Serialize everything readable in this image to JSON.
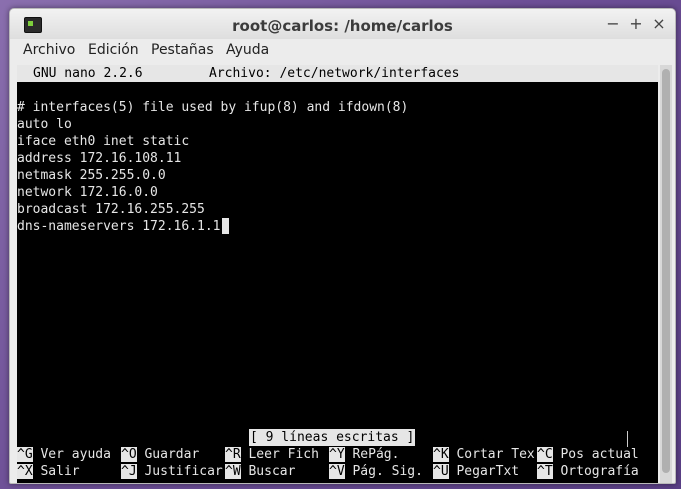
{
  "window": {
    "title": "root@carlos: /home/carlos"
  },
  "menu": [
    "Archivo",
    "Edición",
    "Pestañas",
    "Ayuda"
  ],
  "nano": {
    "version": "GNU nano 2.2.6",
    "file": "Archivo: /etc/network/interfaces",
    "lines": [
      "",
      "# interfaces(5) file used by ifup(8) and ifdown(8)",
      "auto lo",
      "iface eth0 inet static",
      "address 172.16.108.11",
      "netmask 255.255.0.0",
      "network 172.16.0.0",
      "broadcast 172.16.255.255",
      "dns-nameservers 172.16.1.1"
    ],
    "status": "[ 9 líneas escritas ]",
    "shortcuts_row1": [
      {
        "key": "^G",
        "label": "Ver ayuda"
      },
      {
        "key": "^O",
        "label": "Guardar"
      },
      {
        "key": "^R",
        "label": "Leer Fich"
      },
      {
        "key": "^Y",
        "label": "RePág."
      },
      {
        "key": "^K",
        "label": "Cortar Tex"
      },
      {
        "key": "^C",
        "label": "Pos actual"
      }
    ],
    "shortcuts_row2": [
      {
        "key": "^X",
        "label": "Salir"
      },
      {
        "key": "^J",
        "label": "Justificar"
      },
      {
        "key": "^W",
        "label": "Buscar"
      },
      {
        "key": "^V",
        "label": "Pág. Sig."
      },
      {
        "key": "^U",
        "label": "PegarTxt"
      },
      {
        "key": "^T",
        "label": "Ortografía"
      }
    ]
  },
  "icons": {
    "window": "terminal-icon",
    "minimize": "minimize-icon",
    "maximize": "maximize-icon",
    "close": "close-icon"
  },
  "colors": {
    "terminal_bg": "#000000",
    "terminal_fg": "#e6e6e6",
    "header_bg": "#e6e6e6"
  }
}
